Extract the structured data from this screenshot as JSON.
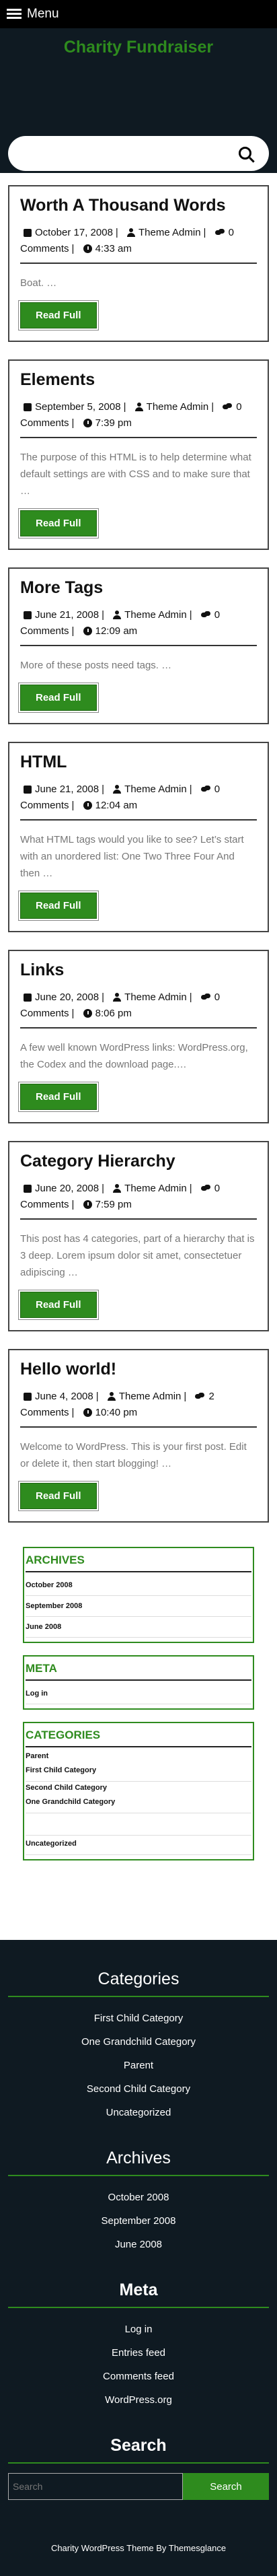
{
  "topbar": {
    "menu_label": "Menu"
  },
  "site": {
    "title": "Charity Fundraiser"
  },
  "posts": [
    {
      "title": "Worth A Thousand Words",
      "date": "October 17, 2008",
      "author": "Theme Admin",
      "comments": "0 Comments",
      "time": "4:33 am",
      "excerpt": "Boat. …",
      "button": "Read Full"
    },
    {
      "title": "Elements",
      "date": "September 5, 2008",
      "author": "Theme Admin",
      "comments": "0 Comments",
      "time": "7:39 pm",
      "excerpt": "The purpose of this HTML is to help determine what default settings are with CSS and to make sure that …",
      "button": "Read Full"
    },
    {
      "title": "More Tags",
      "date": "June 21, 2008",
      "author": "Theme Admin",
      "comments": "0 Comments",
      "time": "12:09 am",
      "excerpt": "More of these posts need tags. …",
      "button": "Read Full"
    },
    {
      "title": "HTML",
      "date": "June 21, 2008",
      "author": "Theme Admin",
      "comments": "0 Comments",
      "time": "12:04 am",
      "excerpt": "What HTML tags would you like to see? Let’s start with an unordered list: One Two Three Four And then …",
      "button": "Read Full"
    },
    {
      "title": "Links",
      "date": "June 20, 2008",
      "author": "Theme Admin",
      "comments": "0 Comments",
      "time": "8:06 pm",
      "excerpt": "A few well known WordPress links: WordPress.org, the Codex and the download page.…",
      "button": "Read Full"
    },
    {
      "title": "Category Hierarchy",
      "date": "June 20, 2008",
      "author": "Theme Admin",
      "comments": "0 Comments",
      "time": "7:59 pm",
      "excerpt": "This post has 4 categories, part of a hierarchy that is 3 deep. Lorem ipsum dolor sit amet, consectetuer adipiscing …",
      "button": "Read Full"
    },
    {
      "title": "Hello world!",
      "date": "June 4, 2008",
      "author": "Theme Admin",
      "comments": "2 Comments",
      "time": "10:40 pm",
      "excerpt": "Welcome to WordPress. This is your first post. Edit or delete it, then start blogging! …",
      "button": "Read Full"
    }
  ],
  "sidebar": {
    "archives": {
      "title": "ARCHIVES",
      "items": [
        "October 2008",
        "September 2008",
        "June 2008"
      ]
    },
    "meta": {
      "title": "META",
      "items": [
        "Log in"
      ]
    },
    "categories": {
      "title": "CATEGORIES",
      "items": [
        "Parent",
        "First Child Category",
        "Second Child Category",
        "One Grandchild Category",
        "Uncategorized"
      ]
    }
  },
  "footer": {
    "categories": {
      "title": "Categories",
      "items": [
        "First Child Category",
        "One Grandchild Category",
        "Parent",
        "Second Child Category",
        "Uncategorized"
      ]
    },
    "archives": {
      "title": "Archives",
      "items": [
        "October 2008",
        "September 2008",
        "June 2008"
      ]
    },
    "meta": {
      "title": "Meta",
      "items": [
        "Log in",
        "Entries feed",
        "Comments feed",
        "WordPress.org"
      ]
    },
    "search": {
      "title": "Search",
      "placeholder": "Search",
      "button": "Search"
    },
    "credit": "Charity WordPress Theme By Themesglance"
  },
  "colors": {
    "accent": "#2e8b1e",
    "dark": "#0f1a22"
  },
  "icons": [
    "menu-icon",
    "search-icon",
    "calendar-icon",
    "user-icon",
    "comments-icon",
    "clock-icon"
  ]
}
